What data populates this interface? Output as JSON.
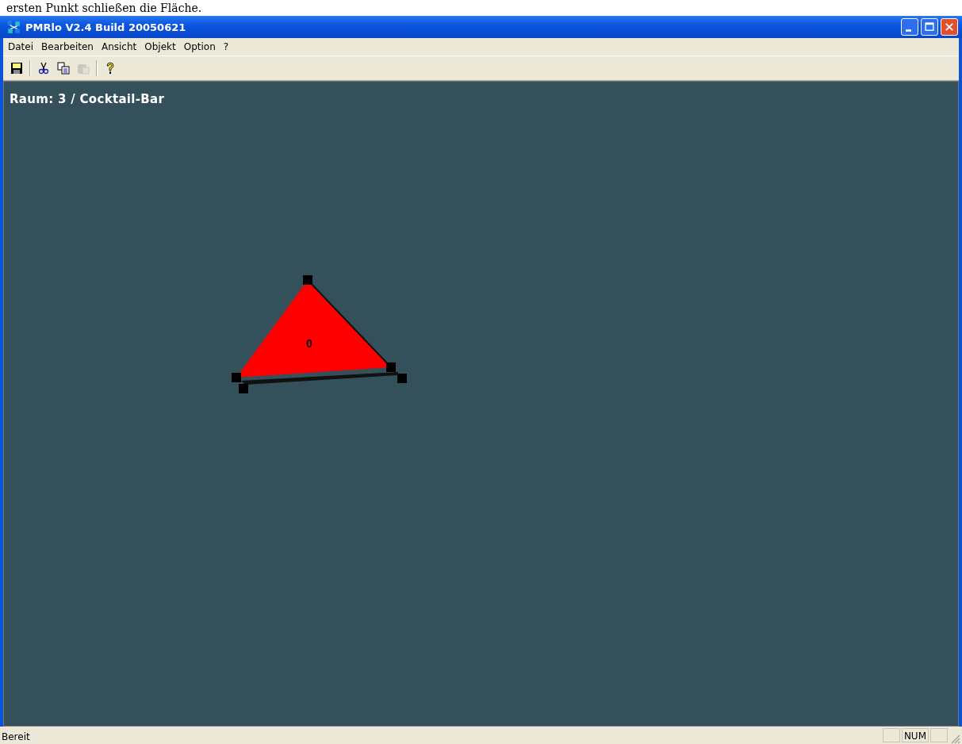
{
  "caption": "ersten Punkt schließen die Fläche.",
  "window": {
    "title": "PMRlo V2.4 Build 20050621"
  },
  "menu": [
    "Datei",
    "Bearbeiten",
    "Ansicht",
    "Objekt",
    "Option",
    "?"
  ],
  "toolbar": [
    {
      "kind": "save",
      "disabled": false
    },
    {
      "kind": "separator"
    },
    {
      "kind": "cut",
      "disabled": false
    },
    {
      "kind": "copy",
      "disabled": false
    },
    {
      "kind": "paste",
      "disabled": true
    },
    {
      "kind": "separator"
    },
    {
      "kind": "help",
      "disabled": false
    }
  ],
  "canvas": {
    "room_title": "Raum: 3 / Cocktail-Bar",
    "shapes": [
      {
        "label": "0",
        "color": "#ff0000",
        "selected": true
      }
    ]
  },
  "status_bar": {
    "text": "Bereit",
    "panels": [
      "NUM"
    ]
  }
}
